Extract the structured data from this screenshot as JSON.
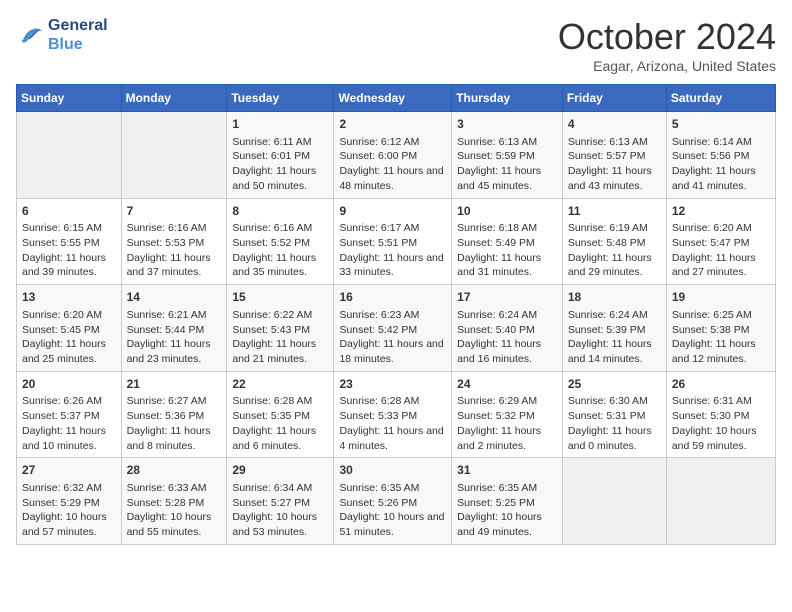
{
  "header": {
    "logo_line1": "General",
    "logo_line2": "Blue",
    "month": "October 2024",
    "location": "Eagar, Arizona, United States"
  },
  "weekdays": [
    "Sunday",
    "Monday",
    "Tuesday",
    "Wednesday",
    "Thursday",
    "Friday",
    "Saturday"
  ],
  "weeks": [
    [
      {
        "day": "",
        "empty": true
      },
      {
        "day": "",
        "empty": true
      },
      {
        "day": "1",
        "sunrise": "6:11 AM",
        "sunset": "6:01 PM",
        "daylight": "11 hours and 50 minutes."
      },
      {
        "day": "2",
        "sunrise": "6:12 AM",
        "sunset": "6:00 PM",
        "daylight": "11 hours and 48 minutes."
      },
      {
        "day": "3",
        "sunrise": "6:13 AM",
        "sunset": "5:59 PM",
        "daylight": "11 hours and 45 minutes."
      },
      {
        "day": "4",
        "sunrise": "6:13 AM",
        "sunset": "5:57 PM",
        "daylight": "11 hours and 43 minutes."
      },
      {
        "day": "5",
        "sunrise": "6:14 AM",
        "sunset": "5:56 PM",
        "daylight": "11 hours and 41 minutes."
      }
    ],
    [
      {
        "day": "6",
        "sunrise": "6:15 AM",
        "sunset": "5:55 PM",
        "daylight": "11 hours and 39 minutes."
      },
      {
        "day": "7",
        "sunrise": "6:16 AM",
        "sunset": "5:53 PM",
        "daylight": "11 hours and 37 minutes."
      },
      {
        "day": "8",
        "sunrise": "6:16 AM",
        "sunset": "5:52 PM",
        "daylight": "11 hours and 35 minutes."
      },
      {
        "day": "9",
        "sunrise": "6:17 AM",
        "sunset": "5:51 PM",
        "daylight": "11 hours and 33 minutes."
      },
      {
        "day": "10",
        "sunrise": "6:18 AM",
        "sunset": "5:49 PM",
        "daylight": "11 hours and 31 minutes."
      },
      {
        "day": "11",
        "sunrise": "6:19 AM",
        "sunset": "5:48 PM",
        "daylight": "11 hours and 29 minutes."
      },
      {
        "day": "12",
        "sunrise": "6:20 AM",
        "sunset": "5:47 PM",
        "daylight": "11 hours and 27 minutes."
      }
    ],
    [
      {
        "day": "13",
        "sunrise": "6:20 AM",
        "sunset": "5:45 PM",
        "daylight": "11 hours and 25 minutes."
      },
      {
        "day": "14",
        "sunrise": "6:21 AM",
        "sunset": "5:44 PM",
        "daylight": "11 hours and 23 minutes."
      },
      {
        "day": "15",
        "sunrise": "6:22 AM",
        "sunset": "5:43 PM",
        "daylight": "11 hours and 21 minutes."
      },
      {
        "day": "16",
        "sunrise": "6:23 AM",
        "sunset": "5:42 PM",
        "daylight": "11 hours and 18 minutes."
      },
      {
        "day": "17",
        "sunrise": "6:24 AM",
        "sunset": "5:40 PM",
        "daylight": "11 hours and 16 minutes."
      },
      {
        "day": "18",
        "sunrise": "6:24 AM",
        "sunset": "5:39 PM",
        "daylight": "11 hours and 14 minutes."
      },
      {
        "day": "19",
        "sunrise": "6:25 AM",
        "sunset": "5:38 PM",
        "daylight": "11 hours and 12 minutes."
      }
    ],
    [
      {
        "day": "20",
        "sunrise": "6:26 AM",
        "sunset": "5:37 PM",
        "daylight": "11 hours and 10 minutes."
      },
      {
        "day": "21",
        "sunrise": "6:27 AM",
        "sunset": "5:36 PM",
        "daylight": "11 hours and 8 minutes."
      },
      {
        "day": "22",
        "sunrise": "6:28 AM",
        "sunset": "5:35 PM",
        "daylight": "11 hours and 6 minutes."
      },
      {
        "day": "23",
        "sunrise": "6:28 AM",
        "sunset": "5:33 PM",
        "daylight": "11 hours and 4 minutes."
      },
      {
        "day": "24",
        "sunrise": "6:29 AM",
        "sunset": "5:32 PM",
        "daylight": "11 hours and 2 minutes."
      },
      {
        "day": "25",
        "sunrise": "6:30 AM",
        "sunset": "5:31 PM",
        "daylight": "11 hours and 0 minutes."
      },
      {
        "day": "26",
        "sunrise": "6:31 AM",
        "sunset": "5:30 PM",
        "daylight": "10 hours and 59 minutes."
      }
    ],
    [
      {
        "day": "27",
        "sunrise": "6:32 AM",
        "sunset": "5:29 PM",
        "daylight": "10 hours and 57 minutes."
      },
      {
        "day": "28",
        "sunrise": "6:33 AM",
        "sunset": "5:28 PM",
        "daylight": "10 hours and 55 minutes."
      },
      {
        "day": "29",
        "sunrise": "6:34 AM",
        "sunset": "5:27 PM",
        "daylight": "10 hours and 53 minutes."
      },
      {
        "day": "30",
        "sunrise": "6:35 AM",
        "sunset": "5:26 PM",
        "daylight": "10 hours and 51 minutes."
      },
      {
        "day": "31",
        "sunrise": "6:35 AM",
        "sunset": "5:25 PM",
        "daylight": "10 hours and 49 minutes."
      },
      {
        "day": "",
        "empty": true
      },
      {
        "day": "",
        "empty": true
      }
    ]
  ],
  "labels": {
    "sunrise_prefix": "Sunrise: ",
    "sunset_prefix": "Sunset: ",
    "daylight_prefix": "Daylight: "
  }
}
